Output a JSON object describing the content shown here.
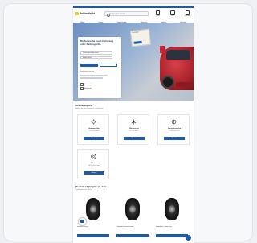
{
  "header": {
    "logo_text": "Reifendirekt",
    "search_placeholder": "Suche nach Reifen",
    "icons": [
      {
        "name": "account-icon",
        "label": "Konto"
      },
      {
        "name": "help-icon",
        "label": "Hilfe"
      },
      {
        "name": "cart-icon",
        "label": "Warenkorb"
      }
    ]
  },
  "nav": {
    "items": [
      "Reifen",
      "Felgen",
      "Kompletträder",
      "Motorrad",
      "Zubehör",
      "Werkstatt"
    ]
  },
  "hero": {
    "title": "Reifensuche nach Fahrzeug oder Reifengröße",
    "button_primary": "Reifen suchen",
    "button_secondary": "Nach Größe",
    "note": "Kostenlose Lieferung",
    "option1": "Sommerreifen",
    "option2": "Winterreifen",
    "select1": "Fahrzeughersteller wählen",
    "select2": "Modell wählen",
    "tag_text": "Testsieger"
  },
  "categories": {
    "title": "Unterkategorie",
    "subtitle": "Wählen Sie eine Kategorie für Ihr Fahrzeug",
    "tiles": [
      {
        "name": "Sommerreifen",
        "desc": "Für warme Monate",
        "button": "Ansehen"
      },
      {
        "name": "Winterreifen",
        "desc": "Für kalte Monate",
        "button": "Ansehen"
      },
      {
        "name": "Ganzjahresreifen",
        "desc": "Für das ganze Jahr",
        "button": "Ansehen"
      },
      {
        "name": "Motorrad",
        "desc": "Reifen für Motorräder",
        "button": "Ansehen"
      }
    ]
  },
  "products": {
    "title": "Produkt-Highlights im Juni",
    "subtitle": "Top-Angebote der Woche",
    "items": [
      {
        "brand": "MICHELIN",
        "name": "Michelin Primacy 4"
      },
      {
        "brand": "CONTINENTAL",
        "name": "Continental PremiumContact"
      },
      {
        "brand": "BRIDGESTONE",
        "name": "Bridgestone Turanza T005"
      }
    ]
  },
  "colors": {
    "primary": "#1e5aa8",
    "accent": "#d0232f"
  }
}
